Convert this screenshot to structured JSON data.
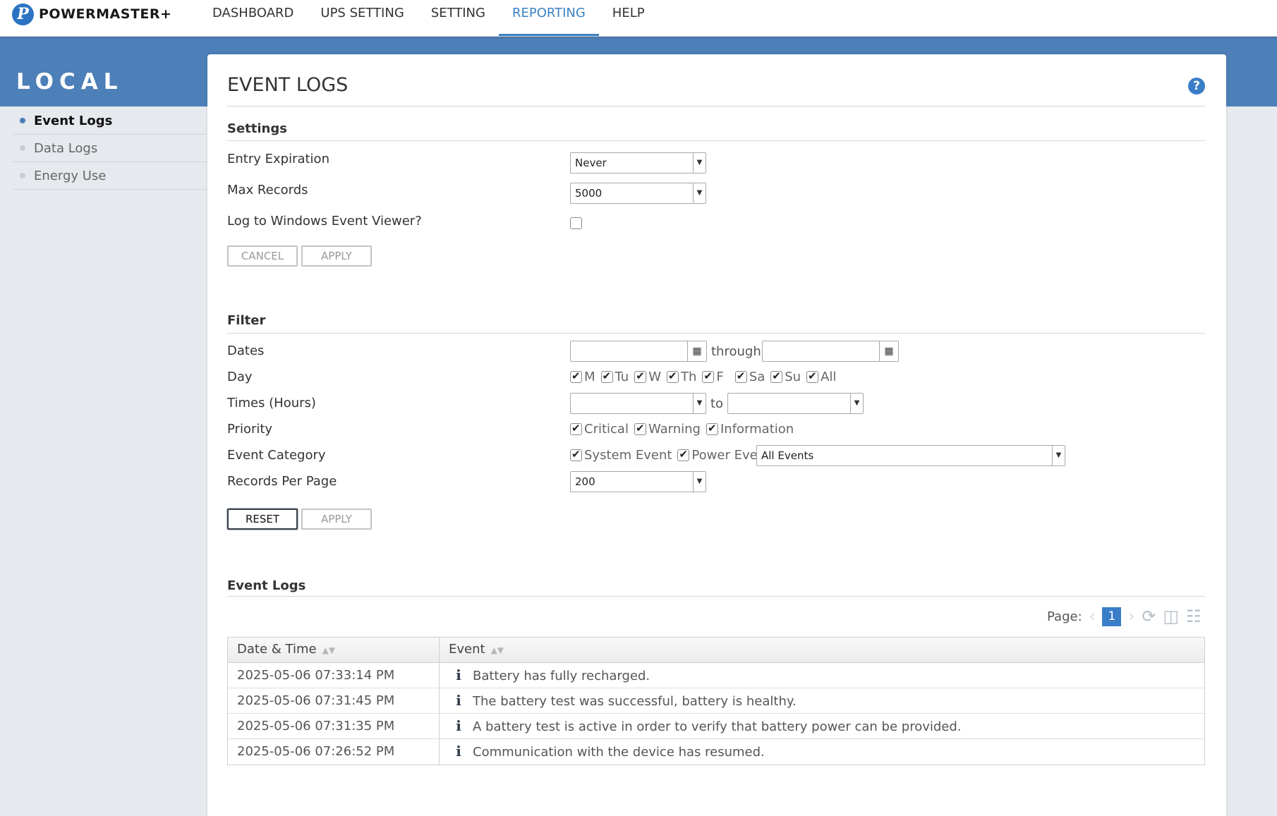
{
  "brand": {
    "name": "POWERMASTER",
    "plus": "+",
    "mark": "P"
  },
  "nav": [
    {
      "label": "DASHBOARD",
      "active": false
    },
    {
      "label": "UPS SETTING",
      "active": false
    },
    {
      "label": "SETTING",
      "active": false
    },
    {
      "label": "REPORTING",
      "active": true
    },
    {
      "label": "HELP",
      "active": false
    }
  ],
  "sidebar": {
    "title": "LOCAL",
    "items": [
      {
        "label": "Event Logs",
        "active": true
      },
      {
        "label": "Data Logs",
        "active": false
      },
      {
        "label": "Energy Use",
        "active": false
      }
    ]
  },
  "page": {
    "title": "EVENT LOGS",
    "help_glyph": "?"
  },
  "settings": {
    "heading": "Settings",
    "entry_expiration": {
      "label": "Entry Expiration",
      "value": "Never"
    },
    "max_records": {
      "label": "Max Records",
      "value": "5000"
    },
    "log_windows": {
      "label": "Log to Windows Event Viewer?",
      "checked": false
    },
    "cancel_label": "CANCEL",
    "apply_label": "APPLY"
  },
  "filter": {
    "heading": "Filter",
    "dates": {
      "label": "Dates",
      "from": "",
      "to": "",
      "through_label": "through"
    },
    "day": {
      "label": "Day",
      "options": [
        {
          "label": "M",
          "checked": true
        },
        {
          "label": "Tu",
          "checked": true
        },
        {
          "label": "W",
          "checked": true
        },
        {
          "label": "Th",
          "checked": true
        },
        {
          "label": "F",
          "checked": true
        },
        {
          "label": "Sa",
          "checked": true
        },
        {
          "label": "Su",
          "checked": true
        },
        {
          "label": "All",
          "checked": true
        }
      ]
    },
    "times": {
      "label": "Times (Hours)",
      "from": "",
      "to": "",
      "to_label": "to"
    },
    "priority": {
      "label": "Priority",
      "options": [
        {
          "label": "Critical",
          "checked": true
        },
        {
          "label": "Warning",
          "checked": true
        },
        {
          "label": "Information",
          "checked": true
        }
      ]
    },
    "event_category": {
      "label": "Event Category",
      "options": [
        {
          "label": "System Event",
          "checked": true
        },
        {
          "label": "Power Event",
          "checked": true
        }
      ],
      "select_value": "All Events"
    },
    "records_per_page": {
      "label": "Records Per Page",
      "value": "200"
    },
    "reset_label": "RESET",
    "apply_label": "APPLY"
  },
  "event_logs": {
    "heading": "Event Logs",
    "pager": {
      "label": "Page:",
      "current": "1"
    },
    "columns": [
      "Date & Time",
      "Event"
    ],
    "rows": [
      {
        "datetime": "2025-05-06 07:33:14 PM",
        "event": "Battery has fully recharged."
      },
      {
        "datetime": "2025-05-06 07:31:45 PM",
        "event": "The battery test was successful, battery is healthy."
      },
      {
        "datetime": "2025-05-06 07:31:35 PM",
        "event": "A battery test is active in order to verify that battery power can be provided."
      },
      {
        "datetime": "2025-05-06 07:26:52 PM",
        "event": "Communication with the device has resumed."
      }
    ]
  },
  "colors": {
    "accent": "#3c82c4",
    "band": "#4d7fb8",
    "background": "#e6e9ed"
  }
}
